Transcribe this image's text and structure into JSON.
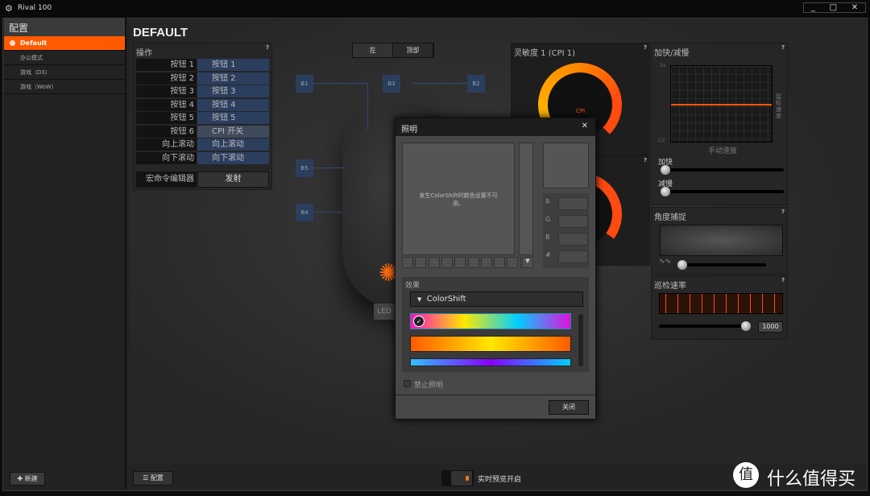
{
  "app": {
    "title": "Rival 100",
    "window_controls": [
      "_",
      "□",
      "✕"
    ]
  },
  "sidebar": {
    "header": "配置",
    "items": [
      {
        "label": "Default",
        "active": true
      },
      {
        "label": "办公模式"
      },
      {
        "label": "游戏（D3）"
      },
      {
        "label": "游戏（WoW）"
      }
    ],
    "new_button": "新建"
  },
  "main": {
    "title": "DEFAULT",
    "actions": {
      "title": "操作",
      "help": "?",
      "rows": [
        {
          "button": "按钮 1",
          "action": "按钮 1"
        },
        {
          "button": "按钮 2",
          "action": "按钮 2"
        },
        {
          "button": "按钮 3",
          "action": "按钮 3"
        },
        {
          "button": "按钮 4",
          "action": "按钮 4"
        },
        {
          "button": "按钮 5",
          "action": "按钮 5"
        },
        {
          "button": "按钮 6",
          "action": "CPI 开关"
        },
        {
          "button": "向上滚动",
          "action": "向上滚动"
        },
        {
          "button": "向下滚动",
          "action": "向下滚动"
        }
      ],
      "macro_label": "宏命令编辑器",
      "macro_button": "发射"
    },
    "view_tabs": [
      "左",
      "顶部"
    ],
    "button_labels": [
      "B1",
      "B3",
      "B2",
      "B5",
      "B4"
    ],
    "led_label": "LED",
    "cpi": {
      "title": "灵敏度 1 (CPI 1)",
      "label": "CPI",
      "help": "?"
    },
    "accel": {
      "title": "加快/减慢",
      "help": "?",
      "y_max": "2x",
      "y_min": "1/2",
      "x_label": "手动速度",
      "y_label": "鼠标速度",
      "accel_label": "加快",
      "decel_label": "减慢"
    },
    "angle": {
      "title": "角度捕捉",
      "help": "?"
    },
    "polling": {
      "title": "巡检速率",
      "help": "?",
      "value": "1000"
    },
    "config_button": "配置",
    "live_preview": "实时预览开启"
  },
  "dialog": {
    "title": "照明",
    "close_x": "✕",
    "message": "发生ColorShift时颜色设置不可用。",
    "rgb_labels": [
      "R",
      "G",
      "B",
      "#"
    ],
    "effect_label": "效果",
    "effect_value": "ColorShift",
    "disable_label": "禁止照明",
    "close_button": "关闭"
  },
  "watermark": "什么值得买",
  "colors": {
    "accent": "#ff5a00",
    "button_blue": "#2c3e5e"
  }
}
